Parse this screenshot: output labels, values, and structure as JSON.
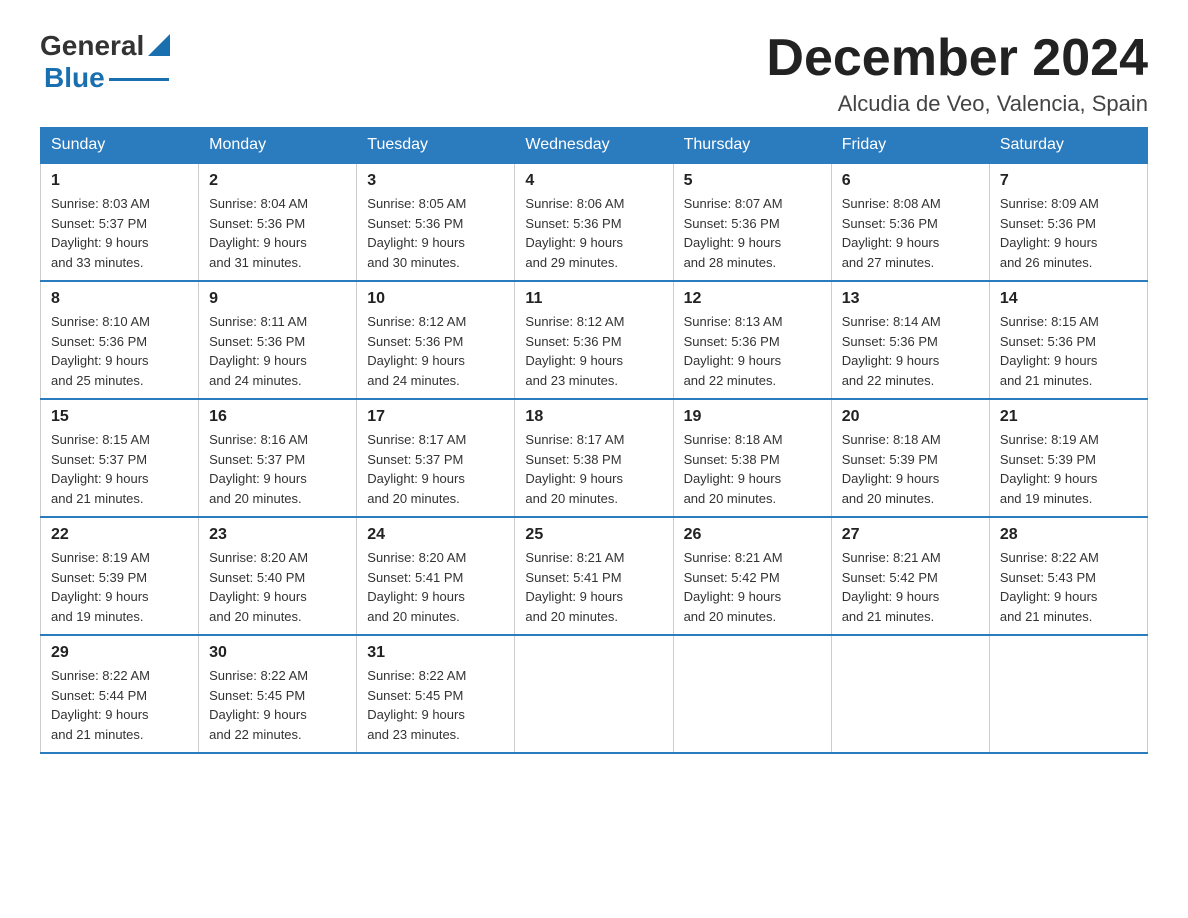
{
  "header": {
    "logo_general": "General",
    "logo_blue": "Blue",
    "month_title": "December 2024",
    "location": "Alcudia de Veo, Valencia, Spain"
  },
  "days_of_week": [
    "Sunday",
    "Monday",
    "Tuesday",
    "Wednesday",
    "Thursday",
    "Friday",
    "Saturday"
  ],
  "weeks": [
    [
      {
        "day": "1",
        "sunrise": "8:03 AM",
        "sunset": "5:37 PM",
        "daylight": "9 hours and 33 minutes."
      },
      {
        "day": "2",
        "sunrise": "8:04 AM",
        "sunset": "5:36 PM",
        "daylight": "9 hours and 31 minutes."
      },
      {
        "day": "3",
        "sunrise": "8:05 AM",
        "sunset": "5:36 PM",
        "daylight": "9 hours and 30 minutes."
      },
      {
        "day": "4",
        "sunrise": "8:06 AM",
        "sunset": "5:36 PM",
        "daylight": "9 hours and 29 minutes."
      },
      {
        "day": "5",
        "sunrise": "8:07 AM",
        "sunset": "5:36 PM",
        "daylight": "9 hours and 28 minutes."
      },
      {
        "day": "6",
        "sunrise": "8:08 AM",
        "sunset": "5:36 PM",
        "daylight": "9 hours and 27 minutes."
      },
      {
        "day": "7",
        "sunrise": "8:09 AM",
        "sunset": "5:36 PM",
        "daylight": "9 hours and 26 minutes."
      }
    ],
    [
      {
        "day": "8",
        "sunrise": "8:10 AM",
        "sunset": "5:36 PM",
        "daylight": "9 hours and 25 minutes."
      },
      {
        "day": "9",
        "sunrise": "8:11 AM",
        "sunset": "5:36 PM",
        "daylight": "9 hours and 24 minutes."
      },
      {
        "day": "10",
        "sunrise": "8:12 AM",
        "sunset": "5:36 PM",
        "daylight": "9 hours and 24 minutes."
      },
      {
        "day": "11",
        "sunrise": "8:12 AM",
        "sunset": "5:36 PM",
        "daylight": "9 hours and 23 minutes."
      },
      {
        "day": "12",
        "sunrise": "8:13 AM",
        "sunset": "5:36 PM",
        "daylight": "9 hours and 22 minutes."
      },
      {
        "day": "13",
        "sunrise": "8:14 AM",
        "sunset": "5:36 PM",
        "daylight": "9 hours and 22 minutes."
      },
      {
        "day": "14",
        "sunrise": "8:15 AM",
        "sunset": "5:36 PM",
        "daylight": "9 hours and 21 minutes."
      }
    ],
    [
      {
        "day": "15",
        "sunrise": "8:15 AM",
        "sunset": "5:37 PM",
        "daylight": "9 hours and 21 minutes."
      },
      {
        "day": "16",
        "sunrise": "8:16 AM",
        "sunset": "5:37 PM",
        "daylight": "9 hours and 20 minutes."
      },
      {
        "day": "17",
        "sunrise": "8:17 AM",
        "sunset": "5:37 PM",
        "daylight": "9 hours and 20 minutes."
      },
      {
        "day": "18",
        "sunrise": "8:17 AM",
        "sunset": "5:38 PM",
        "daylight": "9 hours and 20 minutes."
      },
      {
        "day": "19",
        "sunrise": "8:18 AM",
        "sunset": "5:38 PM",
        "daylight": "9 hours and 20 minutes."
      },
      {
        "day": "20",
        "sunrise": "8:18 AM",
        "sunset": "5:39 PM",
        "daylight": "9 hours and 20 minutes."
      },
      {
        "day": "21",
        "sunrise": "8:19 AM",
        "sunset": "5:39 PM",
        "daylight": "9 hours and 19 minutes."
      }
    ],
    [
      {
        "day": "22",
        "sunrise": "8:19 AM",
        "sunset": "5:39 PM",
        "daylight": "9 hours and 19 minutes."
      },
      {
        "day": "23",
        "sunrise": "8:20 AM",
        "sunset": "5:40 PM",
        "daylight": "9 hours and 20 minutes."
      },
      {
        "day": "24",
        "sunrise": "8:20 AM",
        "sunset": "5:41 PM",
        "daylight": "9 hours and 20 minutes."
      },
      {
        "day": "25",
        "sunrise": "8:21 AM",
        "sunset": "5:41 PM",
        "daylight": "9 hours and 20 minutes."
      },
      {
        "day": "26",
        "sunrise": "8:21 AM",
        "sunset": "5:42 PM",
        "daylight": "9 hours and 20 minutes."
      },
      {
        "day": "27",
        "sunrise": "8:21 AM",
        "sunset": "5:42 PM",
        "daylight": "9 hours and 21 minutes."
      },
      {
        "day": "28",
        "sunrise": "8:22 AM",
        "sunset": "5:43 PM",
        "daylight": "9 hours and 21 minutes."
      }
    ],
    [
      {
        "day": "29",
        "sunrise": "8:22 AM",
        "sunset": "5:44 PM",
        "daylight": "9 hours and 21 minutes."
      },
      {
        "day": "30",
        "sunrise": "8:22 AM",
        "sunset": "5:45 PM",
        "daylight": "9 hours and 22 minutes."
      },
      {
        "day": "31",
        "sunrise": "8:22 AM",
        "sunset": "5:45 PM",
        "daylight": "9 hours and 23 minutes."
      },
      null,
      null,
      null,
      null
    ]
  ],
  "labels": {
    "sunrise": "Sunrise:",
    "sunset": "Sunset:",
    "daylight": "Daylight:"
  }
}
